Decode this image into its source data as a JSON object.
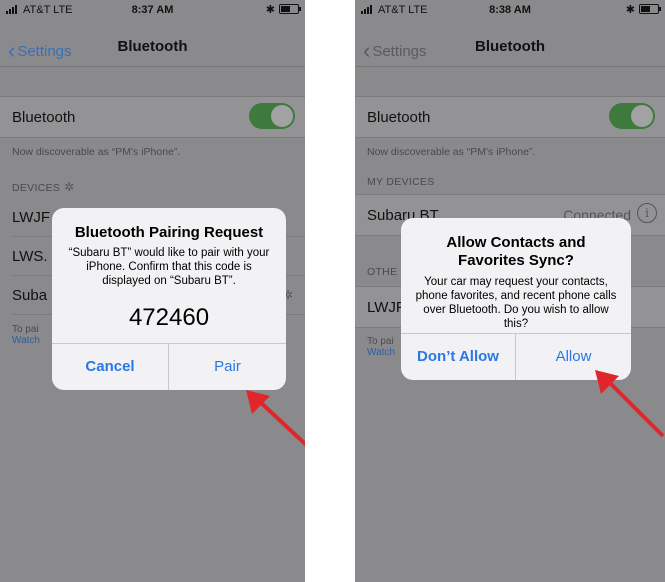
{
  "left": {
    "status": {
      "carrier": "AT&T  LTE",
      "time": "8:37 AM",
      "bt": "✱"
    },
    "nav": {
      "back": "Settings",
      "title": "Bluetooth"
    },
    "bluetooth_label": "Bluetooth",
    "discoverable": "Now discoverable as “PM's iPhone”.",
    "devices_header": "DEVICES",
    "devices": [
      "LWJF",
      "LWS.",
      "Suba"
    ],
    "footer_text": "To pai",
    "footer_link": "Watch",
    "alert": {
      "title": "Bluetooth Pairing Request",
      "message": "“Subaru BT” would like to pair with your iPhone. Confirm that this code is displayed on “Subaru BT”.",
      "code": "472460",
      "cancel": "Cancel",
      "confirm": "Pair"
    }
  },
  "right": {
    "status": {
      "carrier": "AT&T  LTE",
      "time": "8:38 AM",
      "bt": "✱"
    },
    "nav": {
      "back": "Settings",
      "title": "Bluetooth"
    },
    "bluetooth_label": "Bluetooth",
    "discoverable": "Now discoverable as “PM's iPhone”.",
    "my_devices_header": "MY DEVICES",
    "device_name": "Subaru BT",
    "device_status": "Connected",
    "other_header": "OTHE",
    "other_device": "LWJF",
    "footer_text": "To pai",
    "footer_link": "Watch",
    "alert": {
      "title": "Allow Contacts and Favorites Sync?",
      "message": "Your car may request your contacts, phone favorites, and recent phone calls over Bluetooth. Do you wish to allow this?",
      "deny": "Don’t Allow",
      "allow": "Allow"
    }
  },
  "colors": {
    "arrow": "#e0262b",
    "alert_button": "#2b78e4",
    "toggle_dim": "#3e7a3e"
  }
}
